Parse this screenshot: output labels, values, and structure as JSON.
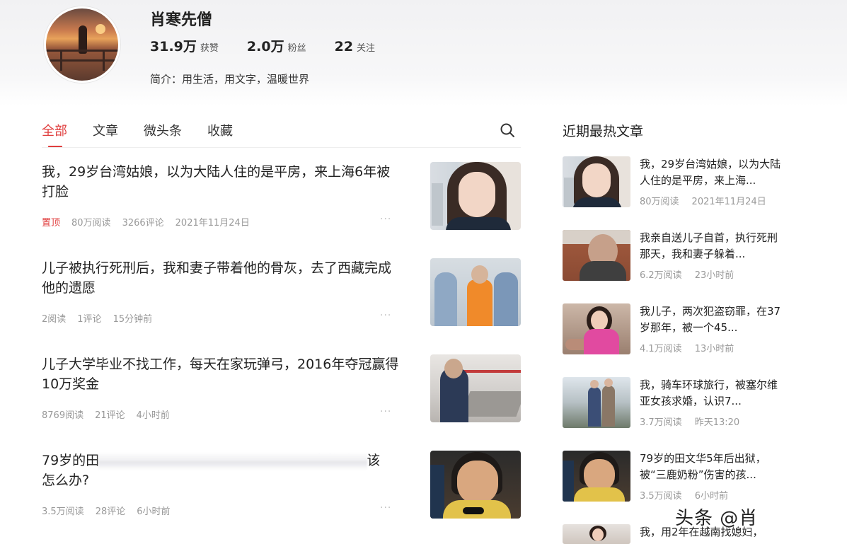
{
  "profile": {
    "name": "肖寒先僧",
    "stats": [
      {
        "value": "31.9万",
        "label": "获赞"
      },
      {
        "value": "2.0万",
        "label": "粉丝"
      },
      {
        "value": "22",
        "label": "关注"
      }
    ],
    "bio": "简介：用生活，用文字，温暖世界"
  },
  "tabs": [
    {
      "label": "全部",
      "active": true
    },
    {
      "label": "文章",
      "active": false
    },
    {
      "label": "微头条",
      "active": false
    },
    {
      "label": "收藏",
      "active": false
    }
  ],
  "search": {
    "icon": "search-icon"
  },
  "feed": [
    {
      "title": "我，29岁台湾姑娘，以为大陆人住的是平房，来上海6年被打脸",
      "pin": "置顶",
      "reads": "80万阅读",
      "comments": "3266评论",
      "time": "2021年11月24日",
      "more": "···"
    },
    {
      "title": "儿子被执行死刑后，我和妻子带着他的骨灰，去了西藏完成他的遗愿",
      "pin": "",
      "reads": "2阅读",
      "comments": "1评论",
      "time": "15分钟前",
      "more": "···"
    },
    {
      "title": "儿子大学毕业不找工作，每天在家玩弹弓，2016年夺冠赢得10万奖金",
      "pin": "",
      "reads": "8769阅读",
      "comments": "21评论",
      "time": "4小时前",
      "more": "···"
    },
    {
      "title_start": "79岁的田",
      "title_end": "害的孩子该",
      "title_line2": "怎么办?",
      "pin": "",
      "reads": "3.5万阅读",
      "comments": "28评论",
      "time": "6小时前",
      "more": "···"
    }
  ],
  "sidebar": {
    "title": "近期最热文章",
    "items": [
      {
        "title": "我，29岁台湾姑娘，以为大陆人住的是平房，来上海...",
        "reads": "80万阅读",
        "time": "2021年11月24日"
      },
      {
        "title": "我亲自送儿子自首，执行死刑那天，我和妻子躲着...",
        "reads": "6.2万阅读",
        "time": "23小时前"
      },
      {
        "title": "我儿子，两次犯盗窃罪，在37岁那年，被一个45...",
        "reads": "4.1万阅读",
        "time": "13小时前"
      },
      {
        "title": "我，骑车环球旅行，被塞尔维亚女孩求婚，认识7...",
        "reads": "3.7万阅读",
        "time": "昨天13:20"
      },
      {
        "title": "79岁的田文华5年后出狱，被“三鹿奶粉”伤害的孩...",
        "reads": "3.5万阅读",
        "time": "6小时前"
      },
      {
        "title": "我，用2年在越南找媳妇，",
        "reads": "",
        "time": ""
      }
    ]
  },
  "watermark": "头条 @肖"
}
